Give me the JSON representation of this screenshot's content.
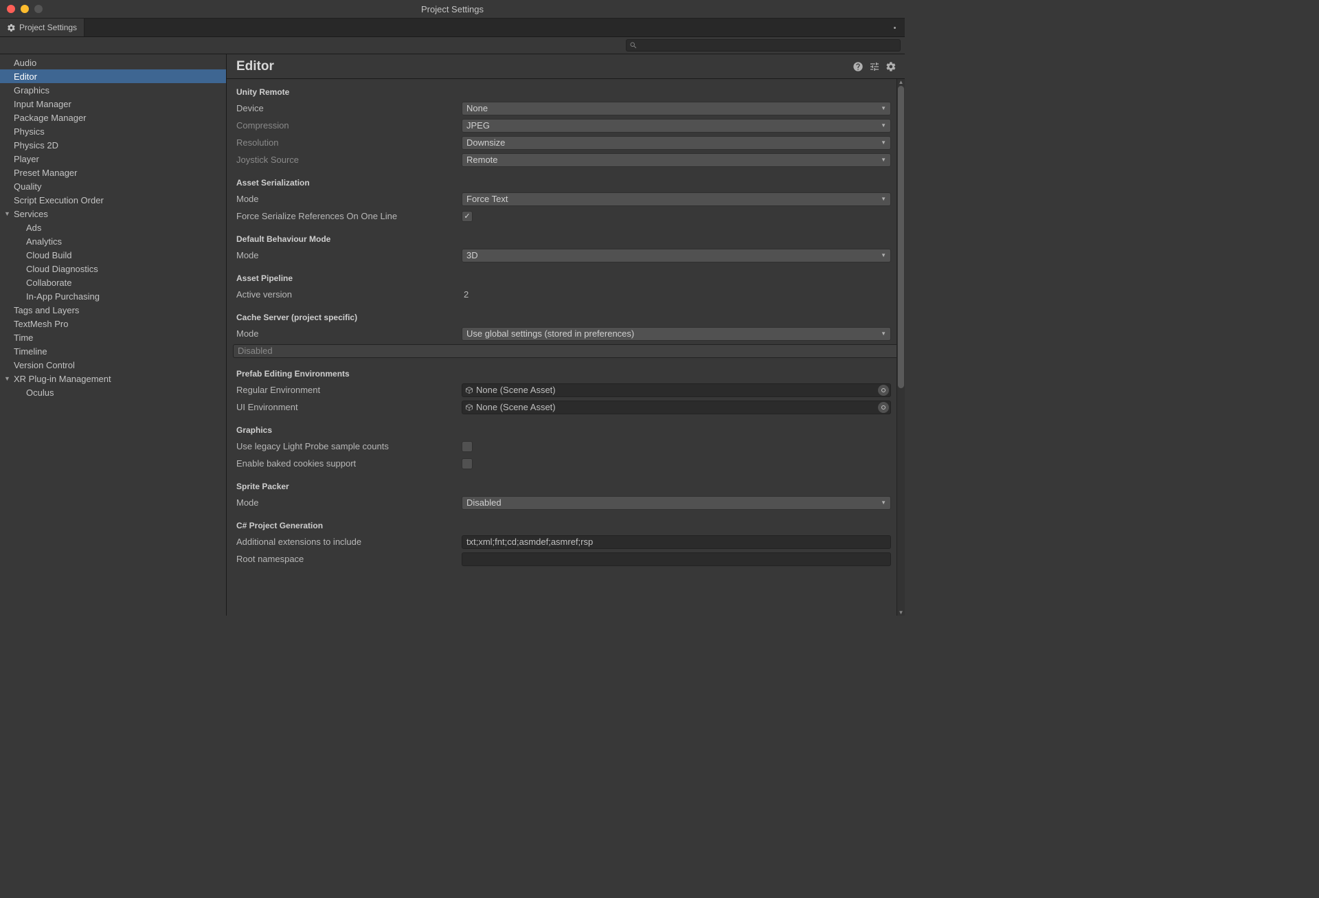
{
  "window": {
    "title": "Project Settings"
  },
  "tab": {
    "label": "Project Settings"
  },
  "sidebar": {
    "items": [
      {
        "label": "Audio"
      },
      {
        "label": "Editor",
        "selected": true
      },
      {
        "label": "Graphics"
      },
      {
        "label": "Input Manager"
      },
      {
        "label": "Package Manager"
      },
      {
        "label": "Physics"
      },
      {
        "label": "Physics 2D"
      },
      {
        "label": "Player"
      },
      {
        "label": "Preset Manager"
      },
      {
        "label": "Quality"
      },
      {
        "label": "Script Execution Order"
      },
      {
        "label": "Services",
        "expandable": true
      },
      {
        "label": "Ads",
        "child": true
      },
      {
        "label": "Analytics",
        "child": true
      },
      {
        "label": "Cloud Build",
        "child": true
      },
      {
        "label": "Cloud Diagnostics",
        "child": true
      },
      {
        "label": "Collaborate",
        "child": true
      },
      {
        "label": "In-App Purchasing",
        "child": true
      },
      {
        "label": "Tags and Layers"
      },
      {
        "label": "TextMesh Pro"
      },
      {
        "label": "Time"
      },
      {
        "label": "Timeline"
      },
      {
        "label": "Version Control"
      },
      {
        "label": "XR Plug-in Management",
        "expandable": true
      },
      {
        "label": "Oculus",
        "child": true
      }
    ]
  },
  "page": {
    "title": "Editor",
    "sections": {
      "unityRemote": {
        "title": "Unity Remote",
        "device": {
          "label": "Device",
          "value": "None"
        },
        "compression": {
          "label": "Compression",
          "value": "JPEG"
        },
        "resolution": {
          "label": "Resolution",
          "value": "Downsize"
        },
        "joystick": {
          "label": "Joystick Source",
          "value": "Remote"
        }
      },
      "assetSer": {
        "title": "Asset Serialization",
        "mode": {
          "label": "Mode",
          "value": "Force Text"
        },
        "forceOneLine": {
          "label": "Force Serialize References On One Line",
          "checked": true
        }
      },
      "behaviour": {
        "title": "Default Behaviour Mode",
        "mode": {
          "label": "Mode",
          "value": "3D"
        }
      },
      "pipeline": {
        "title": "Asset Pipeline",
        "active": {
          "label": "Active version",
          "value": "2"
        }
      },
      "cache": {
        "title": "Cache Server (project specific)",
        "mode": {
          "label": "Mode",
          "value": "Use global settings (stored in preferences)"
        },
        "status": "Disabled"
      },
      "prefab": {
        "title": "Prefab Editing Environments",
        "regular": {
          "label": "Regular Environment",
          "value": "None (Scene Asset)"
        },
        "ui": {
          "label": "UI Environment",
          "value": "None (Scene Asset)"
        }
      },
      "graphics": {
        "title": "Graphics",
        "lightProbe": {
          "label": "Use legacy Light Probe sample counts",
          "checked": false
        },
        "bakedCookies": {
          "label": "Enable baked cookies support",
          "checked": false
        }
      },
      "sprite": {
        "title": "Sprite Packer",
        "mode": {
          "label": "Mode",
          "value": "Disabled"
        }
      },
      "csharp": {
        "title": "C# Project Generation",
        "ext": {
          "label": "Additional extensions to include",
          "value": "txt;xml;fnt;cd;asmdef;asmref;rsp"
        },
        "ns": {
          "label": "Root namespace",
          "value": ""
        }
      }
    }
  }
}
